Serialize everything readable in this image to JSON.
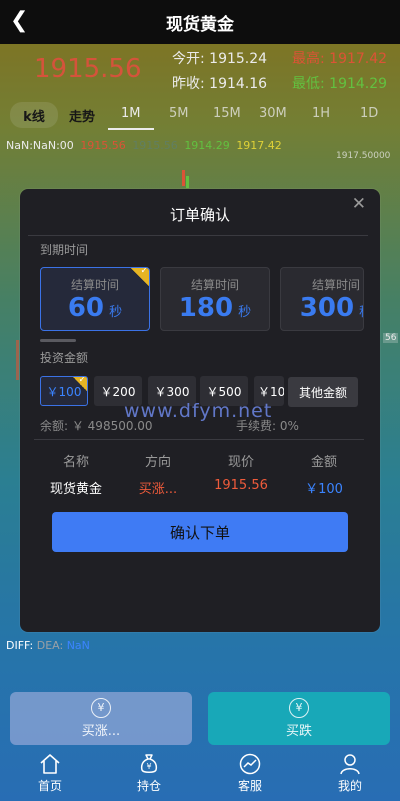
{
  "header": {
    "title": "现货黄金",
    "back_icon": "chevron-left-icon"
  },
  "quote": {
    "price": "1915.56",
    "open_label": "今开:",
    "open": "1915.24",
    "high_label": "最高:",
    "high": "1917.42",
    "prev_close_label": "昨收:",
    "prev_close": "1914.16",
    "low_label": "最低:",
    "low": "1914.29"
  },
  "period_bar": {
    "kline": "k线",
    "trend": "走势",
    "tabs": [
      "1M",
      "5M",
      "15M",
      "30M",
      "1H",
      "1D"
    ],
    "active_tab": "1M"
  },
  "ohlc_line": {
    "time": "NaN:NaN:00",
    "open": "1915.56",
    "close": "1915.56",
    "low": "1914.29",
    "high": "1917.42"
  },
  "chart_axis": {
    "top_label": "1917.50000",
    "mid_label": "56"
  },
  "modal": {
    "title": "订单确认",
    "close_icon": "close-icon",
    "expiry_label": "到期时间",
    "settle_label": "结算时间",
    "durations": [
      {
        "value": "60",
        "unit": "秒",
        "selected": true
      },
      {
        "value": "180",
        "unit": "秒",
        "selected": false
      },
      {
        "value": "300",
        "unit": "秒",
        "selected": false
      }
    ],
    "amount_label": "投资金额",
    "amounts": [
      {
        "label": "￥100",
        "selected": true
      },
      {
        "label": "￥200",
        "selected": false
      },
      {
        "label": "￥300",
        "selected": false
      },
      {
        "label": "￥500",
        "selected": false
      },
      {
        "label": "￥10",
        "selected": false
      }
    ],
    "other_amount": "其他金额",
    "balance": "余额: ￥ 498500.00",
    "fee": "手续费: 0%",
    "table_headers": [
      "名称",
      "方向",
      "现价",
      "金额"
    ],
    "row": {
      "name": "现货黄金",
      "direction": "买涨...",
      "price": "1915.56",
      "amount": "￥100"
    },
    "confirm_label": "确认下单"
  },
  "watermark": "www.dfym.net",
  "indicator": {
    "diff": "DIFF:",
    "dea": "DEA:",
    "dea_val": "NaN"
  },
  "trade_buttons": {
    "buy_up": "买涨...",
    "buy_down": "买跌",
    "icon": "yuan-coin-icon"
  },
  "nav": [
    {
      "label": "首页",
      "icon": "home-icon"
    },
    {
      "label": "持仓",
      "icon": "money-bag-icon"
    },
    {
      "label": "客服",
      "icon": "chart-circle-icon"
    },
    {
      "label": "我的",
      "icon": "user-icon"
    }
  ],
  "colors": {
    "accent": "#3f7bf4",
    "up": "#ef5b3b",
    "down": "#6bd246",
    "modal_bg": "#1f1f24"
  }
}
